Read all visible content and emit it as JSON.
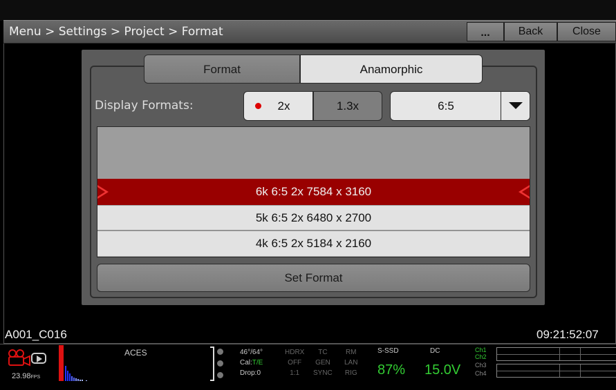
{
  "titlebar": {
    "breadcrumb": "Menu > Settings > Project > Format",
    "more_label": "...",
    "back_label": "Back",
    "close_label": "Close"
  },
  "tabs": [
    {
      "label": "Format",
      "active": false
    },
    {
      "label": "Anamorphic",
      "active": true
    }
  ],
  "display_formats": {
    "label": "Display Formats:",
    "options": [
      "2x",
      "1.3x"
    ],
    "selected": "2x",
    "ratio_value": "6:5"
  },
  "format_list": [
    {
      "label": "6k 6:5 2x 7584 x 3160",
      "selected": true
    },
    {
      "label": "5k 6:5 2x 6480 x 2700",
      "selected": false
    },
    {
      "label": "4k 6:5 2x 5184 x 2160",
      "selected": false
    }
  ],
  "set_format_label": "Set Format",
  "clip_name": "A001_C016",
  "timecode": "09:21:52:07",
  "status": {
    "fps_value": "23.98",
    "fps_unit": "FPS",
    "color_space": "ACES",
    "temp": "46°/64°",
    "cal_prefix": "Cal:",
    "cal_value": "T/E",
    "drop": "Drop:0",
    "hdrx": [
      "HDRX",
      "OFF",
      "1:1"
    ],
    "tc": [
      "TC",
      "GEN",
      "SYNC"
    ],
    "rm": [
      "RM",
      "LAN",
      "RIG"
    ],
    "media_label": "S-SSD",
    "media_value": "87%",
    "power_label": "DC",
    "power_value": "15.0V",
    "channels": [
      "Ch1",
      "Ch2",
      "Ch3",
      "Ch4"
    ]
  },
  "colors": {
    "selected_row": "#990000",
    "accent_green": "#33cc33",
    "record_red": "#dd1111"
  }
}
